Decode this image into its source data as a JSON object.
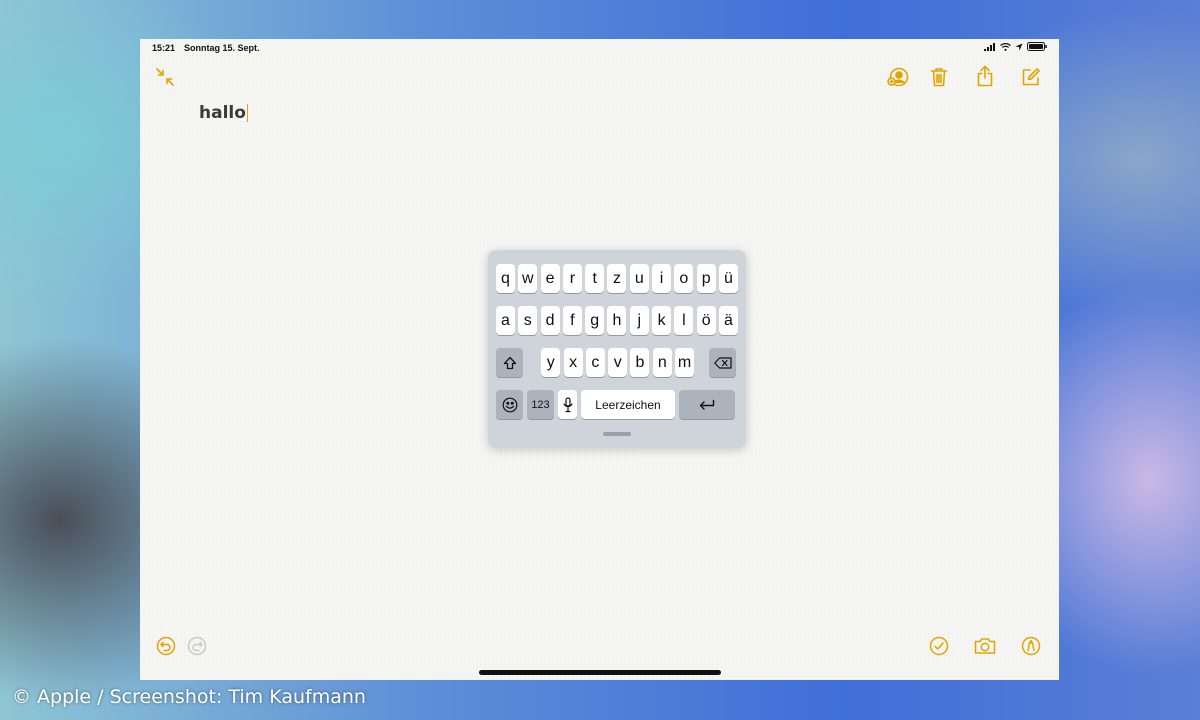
{
  "status": {
    "time": "15:21",
    "date": "Sonntag 15. Sept."
  },
  "note": {
    "text": "hallo"
  },
  "toolbar_top": {
    "collapse_icon": "collapse-arrows-icon",
    "add_person_icon": "add-person-icon",
    "trash_icon": "trash-icon",
    "share_icon": "share-icon",
    "compose_icon": "compose-icon"
  },
  "toolbar_bottom": {
    "undo_icon": "undo-icon",
    "redo_icon": "redo-icon",
    "checklist_icon": "checklist-icon",
    "camera_icon": "camera-icon",
    "markup_icon": "markup-icon"
  },
  "keyboard": {
    "row1": [
      "q",
      "w",
      "e",
      "r",
      "t",
      "z",
      "u",
      "i",
      "o",
      "p",
      "ü"
    ],
    "row2": [
      "a",
      "s",
      "d",
      "f",
      "g",
      "h",
      "j",
      "k",
      "l",
      "ö",
      "ä"
    ],
    "row3": [
      "y",
      "x",
      "c",
      "v",
      "b",
      "n",
      "m"
    ],
    "numbers_label": "123",
    "space_label": "Leerzeichen"
  },
  "colors": {
    "accent": "#e2a400"
  },
  "watermark": "© Apple / Screenshot: Tim Kaufmann"
}
